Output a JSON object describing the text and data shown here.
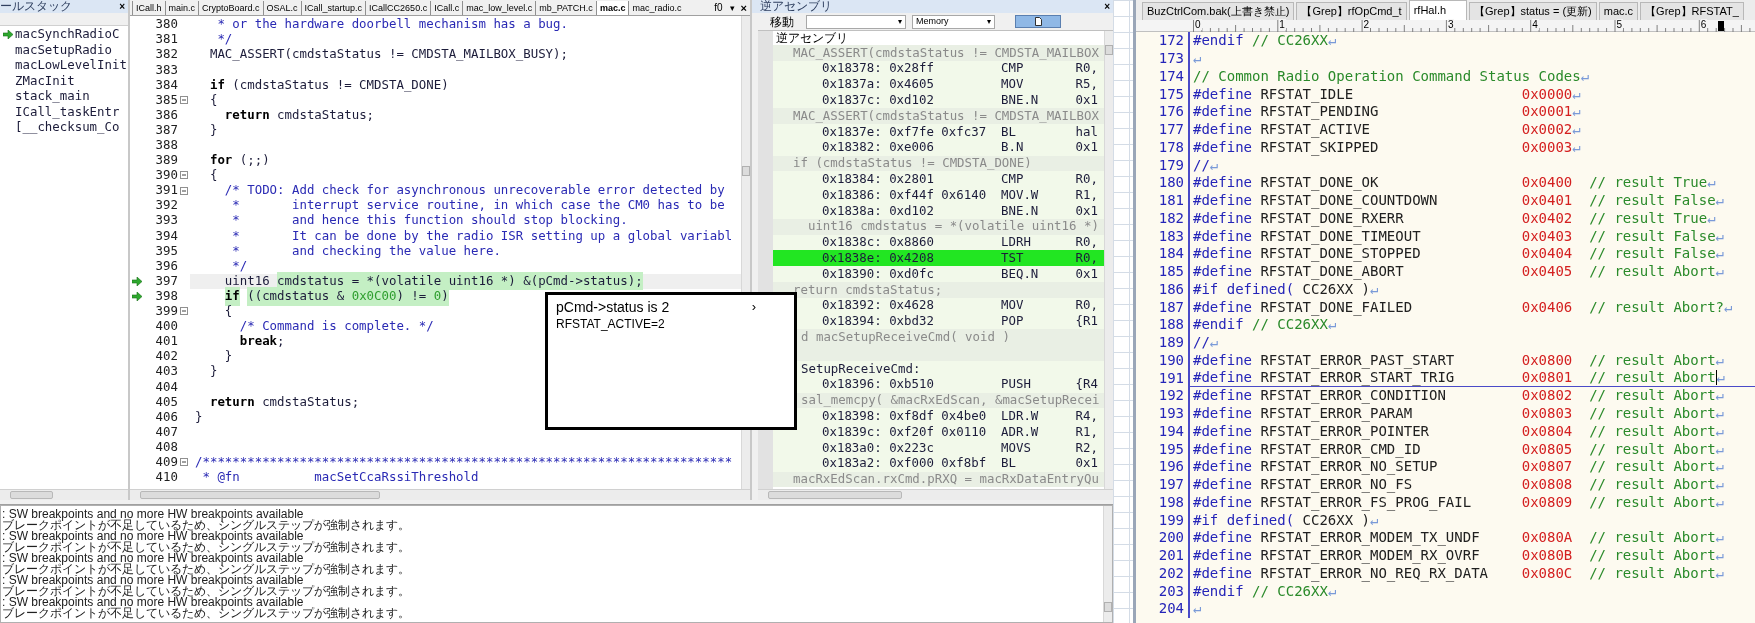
{
  "call_stack": {
    "title": "ールスタック",
    "close": "×",
    "frames": [
      {
        "name": "macSynchRadioC",
        "current": true
      },
      {
        "name": "macSetupRadio",
        "current": false
      },
      {
        "name": "macLowLevelInit",
        "current": false
      },
      {
        "name": "ZMacInit",
        "current": false
      },
      {
        "name": "stack_main",
        "current": false
      },
      {
        "name": "ICall_taskEntr",
        "current": false
      },
      {
        "name": "[__checksum_Co",
        "current": false
      }
    ]
  },
  "editor": {
    "tabs": [
      {
        "label": "ICall.h",
        "selected": false
      },
      {
        "label": "main.c",
        "selected": false
      },
      {
        "label": "CryptoBoard.c",
        "selected": false
      },
      {
        "label": "OSAL.c",
        "selected": false
      },
      {
        "label": "ICall_startup.c",
        "selected": false
      },
      {
        "label": "ICallCC2650.c",
        "selected": false
      },
      {
        "label": "ICall.c",
        "selected": false
      },
      {
        "label": "mac_low_level.c",
        "selected": false
      },
      {
        "label": "mb_PATCH.c",
        "selected": false
      },
      {
        "label": "mac.c",
        "selected": true
      },
      {
        "label": "mac_radio.c",
        "selected": false
      }
    ],
    "tab_menu": "f0",
    "dropdown": "▾",
    "close": "×",
    "lines": [
      {
        "number": "380",
        "arrow": false,
        "current": false,
        "fold": false,
        "segments": [
          {
            "text": "   * or the hardware doorbell mechanism has a bug.",
            "kind": "comment",
            "highlighted": false
          }
        ]
      },
      {
        "number": "381",
        "arrow": false,
        "current": false,
        "fold": false,
        "segments": [
          {
            "text": "   */",
            "kind": "comment",
            "highlighted": false
          }
        ]
      },
      {
        "number": "382",
        "arrow": false,
        "current": false,
        "fold": false,
        "segments": [
          {
            "text": "  MAC_ASSERT(cmdstaStatus != CMDSTA_MAILBOX_BUSY);",
            "kind": "plain",
            "highlighted": false
          }
        ]
      },
      {
        "number": "383",
        "arrow": false,
        "current": false,
        "fold": false
      },
      {
        "number": "384",
        "arrow": false,
        "current": false,
        "fold": false,
        "segments": [
          {
            "text": "  if",
            "kind": "keyword",
            "highlighted": false
          },
          {
            "text": " (cmdstaStatus != CMDSTA_DONE)",
            "kind": "plain",
            "highlighted": false
          }
        ]
      },
      {
        "number": "385",
        "arrow": false,
        "current": false,
        "fold": true,
        "segments": [
          {
            "text": "  {",
            "kind": "plain",
            "highlighted": false
          }
        ]
      },
      {
        "number": "386",
        "arrow": false,
        "current": false,
        "fold": false,
        "segments": [
          {
            "text": "    return",
            "kind": "keyword",
            "highlighted": false
          },
          {
            "text": " cmdstaStatus;",
            "kind": "plain",
            "highlighted": false
          }
        ]
      },
      {
        "number": "387",
        "arrow": false,
        "current": false,
        "fold": false,
        "segments": [
          {
            "text": "  }",
            "kind": "plain",
            "highlighted": false
          }
        ]
      },
      {
        "number": "388",
        "arrow": false,
        "current": false,
        "fold": false
      },
      {
        "number": "389",
        "arrow": false,
        "current": false,
        "fold": false,
        "segments": [
          {
            "text": "  for",
            "kind": "keyword",
            "highlighted": false
          },
          {
            "text": " (;;)",
            "kind": "plain",
            "highlighted": false
          }
        ]
      },
      {
        "number": "390",
        "arrow": false,
        "current": false,
        "fold": true,
        "segments": [
          {
            "text": "  {",
            "kind": "plain",
            "highlighted": false
          }
        ]
      },
      {
        "number": "391",
        "arrow": false,
        "current": false,
        "fold": true,
        "segments": [
          {
            "text": "    /* TODO: Add check for asynchronous unrecoverable error detected by",
            "kind": "comment",
            "highlighted": false
          }
        ]
      },
      {
        "number": "392",
        "arrow": false,
        "current": false,
        "fold": false,
        "segments": [
          {
            "text": "     *       interrupt service routine, in which case the CM0 has to be",
            "kind": "comment",
            "highlighted": false
          }
        ]
      },
      {
        "number": "393",
        "arrow": false,
        "current": false,
        "fold": false,
        "segments": [
          {
            "text": "     *       and hence this function should stop blocking.",
            "kind": "comment",
            "highlighted": false
          }
        ]
      },
      {
        "number": "394",
        "arrow": false,
        "current": false,
        "fold": false,
        "segments": [
          {
            "text": "     *       It can be done by the radio ISR setting up a global variabl",
            "kind": "comment",
            "highlighted": false
          }
        ]
      },
      {
        "number": "395",
        "arrow": false,
        "current": false,
        "fold": false,
        "segments": [
          {
            "text": "     *       and checking the value here.",
            "kind": "comment",
            "highlighted": false
          }
        ]
      },
      {
        "number": "396",
        "arrow": false,
        "current": false,
        "fold": false,
        "segments": [
          {
            "text": "     */",
            "kind": "comment",
            "highlighted": false
          }
        ]
      },
      {
        "number": "397",
        "arrow": true,
        "current": true,
        "fold": false,
        "segments": [
          {
            "text": "    uint16 ",
            "kind": "plain",
            "highlighted": false
          },
          {
            "text": "cmdstatus = *(volatile uint16 *) &(pCmd->status);",
            "kind": "plain",
            "highlighted": true
          }
        ]
      },
      {
        "number": "398",
        "arrow": true,
        "current": false,
        "fold": false,
        "segments": [
          {
            "text": "    if",
            "kind": "keyword",
            "highlighted": true
          },
          {
            "text": " ((cmdstatus & ",
            "kind": "plain",
            "highlighted": true
          },
          {
            "text": "0x0C00",
            "kind": "number",
            "highlighted": true
          },
          {
            "text": ") != ",
            "kind": "plain",
            "highlighted": true
          },
          {
            "text": "0",
            "kind": "number",
            "highlighted": true
          },
          {
            "text": ")",
            "kind": "plain",
            "highlighted": true
          }
        ]
      },
      {
        "number": "399",
        "arrow": false,
        "current": false,
        "fold": true,
        "segments": [
          {
            "text": "    {",
            "kind": "plain",
            "highlighted": false
          }
        ]
      },
      {
        "number": "400",
        "arrow": false,
        "current": false,
        "fold": false,
        "segments": [
          {
            "text": "      /* Command is complete. */",
            "kind": "comment",
            "highlighted": false
          }
        ]
      },
      {
        "number": "401",
        "arrow": false,
        "current": false,
        "fold": false,
        "segments": [
          {
            "text": "      break",
            "kind": "keyword",
            "highlighted": false
          },
          {
            "text": ";",
            "kind": "plain",
            "highlighted": false
          }
        ]
      },
      {
        "number": "402",
        "arrow": false,
        "current": false,
        "fold": false,
        "segments": [
          {
            "text": "    }",
            "kind": "plain",
            "highlighted": false
          }
        ]
      },
      {
        "number": "403",
        "arrow": false,
        "current": false,
        "fold": false,
        "segments": [
          {
            "text": "  }",
            "kind": "plain",
            "highlighted": false
          }
        ]
      },
      {
        "number": "404",
        "arrow": false,
        "current": false,
        "fold": false
      },
      {
        "number": "405",
        "arrow": false,
        "current": false,
        "fold": false,
        "segments": [
          {
            "text": "  return",
            "kind": "keyword",
            "highlighted": false
          },
          {
            "text": " cmdstaStatus;",
            "kind": "plain",
            "highlighted": false
          }
        ]
      },
      {
        "number": "406",
        "arrow": false,
        "current": false,
        "fold": false,
        "segments": [
          {
            "text": "}",
            "kind": "plain",
            "highlighted": false
          }
        ]
      },
      {
        "number": "407",
        "arrow": false,
        "current": false,
        "fold": false
      },
      {
        "number": "408",
        "arrow": false,
        "current": false,
        "fold": false
      },
      {
        "number": "409",
        "arrow": false,
        "current": false,
        "fold": true,
        "segments": [
          {
            "text": "/***********************************************************************",
            "kind": "comment",
            "highlighted": false
          }
        ]
      },
      {
        "number": "410",
        "arrow": false,
        "current": false,
        "fold": false,
        "segments": [
          {
            "text": " * @fn          macSetCcaRssiThreshold",
            "kind": "comment",
            "highlighted": false
          }
        ]
      }
    ]
  },
  "tooltip": {
    "title": "pCmd->status is 2",
    "more": "›",
    "detail": "RFSTAT_ACTIVE=2"
  },
  "disassembly": {
    "title": "逆アセンブリ",
    "close": "×",
    "goto_label": "移動",
    "memory_select": "Memory",
    "dropdown": "▾",
    "column_header": "逆アセンブリ",
    "rows": [
      {
        "kind": "source",
        "text": "MAC_ASSERT(cmdstaStatus != CMDSTA_MAILBOX",
        "covered": false
      },
      {
        "kind": "instruction",
        "address": "0x18378:",
        "opcode": "0x28ff",
        "mnemonic": "CMP",
        "operand": "R0,",
        "current": false
      },
      {
        "kind": "instruction",
        "address": "0x1837a:",
        "opcode": "0x4605",
        "mnemonic": "MOV",
        "operand": "R5,",
        "current": false
      },
      {
        "kind": "instruction",
        "address": "0x1837c:",
        "opcode": "0xd102",
        "mnemonic": "BNE.N",
        "operand": "0x1",
        "current": false
      },
      {
        "kind": "source",
        "text": "MAC_ASSERT(cmdstaStatus != CMDSTA_MAILBOX",
        "covered": false
      },
      {
        "kind": "instruction",
        "address": "0x1837e:",
        "opcode": "0xf7fe 0xfc37",
        "mnemonic": "BL",
        "operand": "hal",
        "current": false
      },
      {
        "kind": "instruction",
        "address": "0x18382:",
        "opcode": "0xe006",
        "mnemonic": "B.N",
        "operand": "0x1",
        "current": false
      },
      {
        "kind": "source",
        "text": "if (cmdstaStatus != CMDSTA_DONE)",
        "covered": false
      },
      {
        "kind": "instruction",
        "address": "0x18384:",
        "opcode": "0x2801",
        "mnemonic": "CMP",
        "operand": "R0,",
        "current": false
      },
      {
        "kind": "instruction",
        "address": "0x18386:",
        "opcode": "0xf44f 0x6140",
        "mnemonic": "MOV.W",
        "operand": "R1,",
        "current": false
      },
      {
        "kind": "instruction",
        "address": "0x1838a:",
        "opcode": "0xd102",
        "mnemonic": "BNE.N",
        "operand": "0x1",
        "current": false
      },
      {
        "kind": "source",
        "text": "  uint16 cmdstatus = *(volatile uint16 *)",
        "covered": false
      },
      {
        "kind": "instruction",
        "address": "0x1838c:",
        "opcode": "0x8860",
        "mnemonic": "LDRH",
        "operand": "R0,",
        "current": false
      },
      {
        "kind": "instruction",
        "address": "0x1838e:",
        "opcode": "0x4208",
        "mnemonic": "TST",
        "operand": "R0,",
        "current": true
      },
      {
        "kind": "instruction",
        "address": "0x18390:",
        "opcode": "0xd0fc",
        "mnemonic": "BEQ.N",
        "operand": "0x1",
        "current": false
      },
      {
        "kind": "source",
        "text": "return cmdstaStatus;",
        "covered": false
      },
      {
        "kind": "instruction",
        "address": "0x18392:",
        "opcode": "0x4628",
        "mnemonic": "MOV",
        "operand": "R0,",
        "current": false
      },
      {
        "kind": "instruction",
        "address": "0x18394:",
        "opcode": "0xbd32",
        "mnemonic": "POP",
        "operand": "{R1",
        "current": false
      },
      {
        "kind": "source",
        "text": "d macSetupReceiveCmd( void )",
        "covered": true
      },
      {
        "kind": "gap"
      },
      {
        "kind": "label",
        "text": "SetupReceiveCmd:",
        "covered": true
      },
      {
        "kind": "instruction",
        "address": "0x18396:",
        "opcode": "0xb510",
        "mnemonic": "PUSH",
        "operand": "{R4",
        "current": false
      },
      {
        "kind": "source",
        "text": "sal_memcpy( &macRxEdScan, &macSetupRecei",
        "covered": true
      },
      {
        "kind": "instruction",
        "address": "0x18398:",
        "opcode": "0xf8df 0x4be0",
        "mnemonic": "LDR.W",
        "operand": "R4,",
        "current": false
      },
      {
        "kind": "instruction",
        "address": "0x1839c:",
        "opcode": "0xf20f 0x0110",
        "mnemonic": "ADR.W",
        "operand": "R1,",
        "current": false
      },
      {
        "kind": "instruction",
        "address": "0x183a0:",
        "opcode": "0x223c",
        "mnemonic": "MOVS",
        "operand": "R2,",
        "current": false
      },
      {
        "kind": "instruction",
        "address": "0x183a2:",
        "opcode": "0xf000 0xf8bf",
        "mnemonic": "BL",
        "operand": "0x1",
        "current": false
      },
      {
        "kind": "source",
        "text": "macRxEdScan.rxCmd.pRXQ = macRxDataEntryQu",
        "covered": false
      }
    ]
  },
  "output": {
    "lines": [
      ": SW breakpoints and no more HW breakpoints available",
      "ブレークポイントが不足しているため、シングルステップが強制されます。",
      ": SW breakpoints and no more HW breakpoints available",
      "ブレークポイントが不足しているため、シングルステップが強制されます。",
      ": SW breakpoints and no more HW breakpoints available",
      "ブレークポイントが不足しているため、シングルステップが強制されます。",
      ": SW breakpoints and no more HW breakpoints available",
      "ブレークポイントが不足しているため、シングルステップが強制されます。",
      ": SW breakpoints and no more HW breakpoints available",
      "ブレークポイントが不足しているため、シングルステップが強制されます。"
    ]
  },
  "text_editor": {
    "tabs": [
      {
        "label": "BuzCtrlCom.bak(上書き禁止)",
        "selected": false
      },
      {
        "label": "【Grep】rfOpCmd_t",
        "selected": false
      },
      {
        "label": "rfHal.h",
        "selected": true
      },
      {
        "label": "【Grep】status = (更新)",
        "selected": false
      },
      {
        "label": "mac.c",
        "selected": false
      },
      {
        "label": "【Grep】RFSTAT_",
        "selected": false
      }
    ],
    "ruler": [
      "0",
      "1",
      "2",
      "3",
      "4",
      "5",
      "6"
    ],
    "lines": [
      {
        "number": "172",
        "kind": "text",
        "cursor": false,
        "eol": "↵",
        "segments": [
          {
            "text": "#endif",
            "kind": "directive"
          },
          {
            "text": " // CC26XX",
            "kind": "comment"
          }
        ]
      },
      {
        "number": "173",
        "kind": "text",
        "cursor": false,
        "eol": "↵"
      },
      {
        "number": "174",
        "kind": "text",
        "cursor": false,
        "eol": "↵",
        "segments": [
          {
            "text": "// Common Radio Operation Command Status Codes",
            "kind": "comment"
          }
        ]
      },
      {
        "number": "175",
        "kind": "define",
        "cursor": false,
        "eol": "↵",
        "keyword": "#define",
        "name": "RFSTAT_IDLE",
        "value": "0x0000"
      },
      {
        "number": "176",
        "kind": "define",
        "cursor": false,
        "eol": "↵",
        "keyword": "#define",
        "name": "RFSTAT_PENDING",
        "value": "0x0001"
      },
      {
        "number": "177",
        "kind": "define",
        "cursor": false,
        "eol": "↵",
        "keyword": "#define",
        "name": "RFSTAT_ACTIVE",
        "value": "0x0002"
      },
      {
        "number": "178",
        "kind": "define",
        "cursor": false,
        "eol": "↵",
        "keyword": "#define",
        "name": "RFSTAT_SKIPPED",
        "value": "0x0003"
      },
      {
        "number": "179",
        "kind": "text",
        "cursor": false,
        "eol": "↵",
        "segments": [
          {
            "text": "//",
            "kind": "directive"
          }
        ]
      },
      {
        "number": "180",
        "kind": "define",
        "cursor": false,
        "eol": "↵",
        "keyword": "#define",
        "name": "RFSTAT_DONE_OK",
        "value": "0x0400",
        "comment": "// result True"
      },
      {
        "number": "181",
        "kind": "define",
        "cursor": false,
        "eol": "↵",
        "keyword": "#define",
        "name": "RFSTAT_DONE_COUNTDOWN",
        "value": "0x0401",
        "comment": "// result False"
      },
      {
        "number": "182",
        "kind": "define",
        "cursor": false,
        "eol": "↵",
        "keyword": "#define",
        "name": "RFSTAT_DONE_RXERR",
        "value": "0x0402",
        "comment": "// result True"
      },
      {
        "number": "183",
        "kind": "define",
        "cursor": false,
        "eol": "↵",
        "keyword": "#define",
        "name": "RFSTAT_DONE_TIMEOUT",
        "value": "0x0403",
        "comment": "// result False"
      },
      {
        "number": "184",
        "kind": "define",
        "cursor": false,
        "eol": "↵",
        "keyword": "#define",
        "name": "RFSTAT_DONE_STOPPED",
        "value": "0x0404",
        "comment": "// result False"
      },
      {
        "number": "185",
        "kind": "define",
        "cursor": false,
        "eol": "↵",
        "keyword": "#define",
        "name": "RFSTAT_DONE_ABORT",
        "value": "0x0405",
        "comment": "// result Abort"
      },
      {
        "number": "186",
        "kind": "text",
        "cursor": false,
        "eol": "↵",
        "segments": [
          {
            "text": "#if defined(",
            "kind": "directive"
          },
          {
            "text": " CC26XX )",
            "kind": "plain"
          }
        ]
      },
      {
        "number": "187",
        "kind": "define",
        "cursor": false,
        "eol": "↵",
        "keyword": "#define",
        "name": "RFSTAT_DONE_FAILED",
        "value": "0x0406",
        "comment": "// result Abort?"
      },
      {
        "number": "188",
        "kind": "text",
        "cursor": false,
        "eol": "↵",
        "segments": [
          {
            "text": "#endif",
            "kind": "directive"
          },
          {
            "text": " // CC26XX",
            "kind": "comment"
          }
        ]
      },
      {
        "number": "189",
        "kind": "text",
        "cursor": false,
        "eol": "↵",
        "segments": [
          {
            "text": "//",
            "kind": "directive"
          }
        ]
      },
      {
        "number": "190",
        "kind": "define",
        "cursor": false,
        "eol": "↵",
        "keyword": "#define",
        "name": "RFSTAT_ERROR_PAST_START",
        "value": "0x0800",
        "comment": "// result Abort"
      },
      {
        "number": "191",
        "kind": "define",
        "cursor": true,
        "eol": "↵",
        "keyword": "#define",
        "name": "RFSTAT_ERROR_START_TRIG",
        "value": "0x0801",
        "comment": "// result Abort"
      },
      {
        "number": "192",
        "kind": "define",
        "cursor": false,
        "eol": "↵",
        "keyword": "#define",
        "name": "RFSTAT_ERROR_CONDITION",
        "value": "0x0802",
        "comment": "// result Abort"
      },
      {
        "number": "193",
        "kind": "define",
        "cursor": false,
        "eol": "↵",
        "keyword": "#define",
        "name": "RFSTAT_ERROR_PARAM",
        "value": "0x0803",
        "comment": "// result Abort"
      },
      {
        "number": "194",
        "kind": "define",
        "cursor": false,
        "eol": "↵",
        "keyword": "#define",
        "name": "RFSTAT_ERROR_POINTER",
        "value": "0x0804",
        "comment": "// result Abort"
      },
      {
        "number": "195",
        "kind": "define",
        "cursor": false,
        "eol": "↵",
        "keyword": "#define",
        "name": "RFSTAT_ERROR_CMD_ID",
        "value": "0x0805",
        "comment": "// result Abort"
      },
      {
        "number": "196",
        "kind": "define",
        "cursor": false,
        "eol": "↵",
        "keyword": "#define",
        "name": "RFSTAT_ERROR_NO_SETUP",
        "value": "0x0807",
        "comment": "// result Abort"
      },
      {
        "number": "197",
        "kind": "define",
        "cursor": false,
        "eol": "↵",
        "keyword": "#define",
        "name": "RFSTAT_ERROR_NO_FS",
        "value": "0x0808",
        "comment": "// result Abort"
      },
      {
        "number": "198",
        "kind": "define",
        "cursor": false,
        "eol": "↵",
        "keyword": "#define",
        "name": "RFSTAT_ERROR_FS_PROG_FAIL",
        "value": "0x0809",
        "comment": "// result Abort"
      },
      {
        "number": "199",
        "kind": "text",
        "cursor": false,
        "eol": "↵",
        "segments": [
          {
            "text": "#if defined(",
            "kind": "directive"
          },
          {
            "text": " CC26XX )",
            "kind": "plain"
          }
        ]
      },
      {
        "number": "200",
        "kind": "define",
        "cursor": false,
        "eol": "↵",
        "keyword": "#define",
        "name": "RFSTAT_ERROR_MODEM_TX_UNDF",
        "value": "0x080A",
        "comment": "// result Abort"
      },
      {
        "number": "201",
        "kind": "define",
        "cursor": false,
        "eol": "↵",
        "keyword": "#define",
        "name": "RFSTAT_ERROR_MODEM_RX_OVRF",
        "value": "0x080B",
        "comment": "// result Abort"
      },
      {
        "number": "202",
        "kind": "define",
        "cursor": false,
        "eol": "↵",
        "keyword": "#define",
        "name": "RFSTAT_ERROR_NO_REQ_RX_DATA",
        "value": "0x080C",
        "comment": "// result Abort"
      },
      {
        "number": "203",
        "kind": "text",
        "cursor": false,
        "eol": "↵",
        "segments": [
          {
            "text": "#endif",
            "kind": "directive"
          },
          {
            "text": " // CC26XX",
            "kind": "comment"
          }
        ]
      },
      {
        "number": "204",
        "kind": "text",
        "cursor": false,
        "eol": "↵"
      }
    ]
  }
}
